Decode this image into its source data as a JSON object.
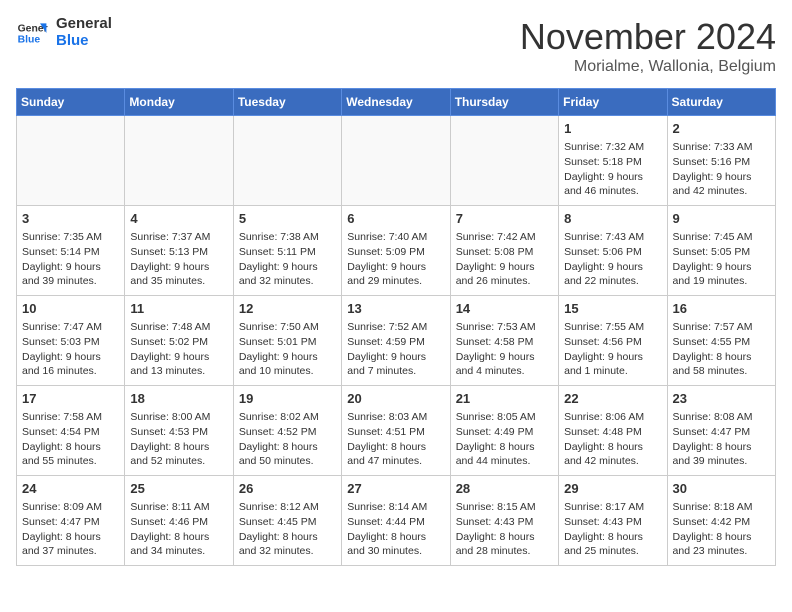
{
  "logo": {
    "line1": "General",
    "line2": "Blue"
  },
  "title": "November 2024",
  "location": "Morialme, Wallonia, Belgium",
  "days_of_week": [
    "Sunday",
    "Monday",
    "Tuesday",
    "Wednesday",
    "Thursday",
    "Friday",
    "Saturday"
  ],
  "weeks": [
    [
      {
        "day": "",
        "info": ""
      },
      {
        "day": "",
        "info": ""
      },
      {
        "day": "",
        "info": ""
      },
      {
        "day": "",
        "info": ""
      },
      {
        "day": "",
        "info": ""
      },
      {
        "day": "1",
        "info": "Sunrise: 7:32 AM\nSunset: 5:18 PM\nDaylight: 9 hours and 46 minutes."
      },
      {
        "day": "2",
        "info": "Sunrise: 7:33 AM\nSunset: 5:16 PM\nDaylight: 9 hours and 42 minutes."
      }
    ],
    [
      {
        "day": "3",
        "info": "Sunrise: 7:35 AM\nSunset: 5:14 PM\nDaylight: 9 hours and 39 minutes."
      },
      {
        "day": "4",
        "info": "Sunrise: 7:37 AM\nSunset: 5:13 PM\nDaylight: 9 hours and 35 minutes."
      },
      {
        "day": "5",
        "info": "Sunrise: 7:38 AM\nSunset: 5:11 PM\nDaylight: 9 hours and 32 minutes."
      },
      {
        "day": "6",
        "info": "Sunrise: 7:40 AM\nSunset: 5:09 PM\nDaylight: 9 hours and 29 minutes."
      },
      {
        "day": "7",
        "info": "Sunrise: 7:42 AM\nSunset: 5:08 PM\nDaylight: 9 hours and 26 minutes."
      },
      {
        "day": "8",
        "info": "Sunrise: 7:43 AM\nSunset: 5:06 PM\nDaylight: 9 hours and 22 minutes."
      },
      {
        "day": "9",
        "info": "Sunrise: 7:45 AM\nSunset: 5:05 PM\nDaylight: 9 hours and 19 minutes."
      }
    ],
    [
      {
        "day": "10",
        "info": "Sunrise: 7:47 AM\nSunset: 5:03 PM\nDaylight: 9 hours and 16 minutes."
      },
      {
        "day": "11",
        "info": "Sunrise: 7:48 AM\nSunset: 5:02 PM\nDaylight: 9 hours and 13 minutes."
      },
      {
        "day": "12",
        "info": "Sunrise: 7:50 AM\nSunset: 5:01 PM\nDaylight: 9 hours and 10 minutes."
      },
      {
        "day": "13",
        "info": "Sunrise: 7:52 AM\nSunset: 4:59 PM\nDaylight: 9 hours and 7 minutes."
      },
      {
        "day": "14",
        "info": "Sunrise: 7:53 AM\nSunset: 4:58 PM\nDaylight: 9 hours and 4 minutes."
      },
      {
        "day": "15",
        "info": "Sunrise: 7:55 AM\nSunset: 4:56 PM\nDaylight: 9 hours and 1 minute."
      },
      {
        "day": "16",
        "info": "Sunrise: 7:57 AM\nSunset: 4:55 PM\nDaylight: 8 hours and 58 minutes."
      }
    ],
    [
      {
        "day": "17",
        "info": "Sunrise: 7:58 AM\nSunset: 4:54 PM\nDaylight: 8 hours and 55 minutes."
      },
      {
        "day": "18",
        "info": "Sunrise: 8:00 AM\nSunset: 4:53 PM\nDaylight: 8 hours and 52 minutes."
      },
      {
        "day": "19",
        "info": "Sunrise: 8:02 AM\nSunset: 4:52 PM\nDaylight: 8 hours and 50 minutes."
      },
      {
        "day": "20",
        "info": "Sunrise: 8:03 AM\nSunset: 4:51 PM\nDaylight: 8 hours and 47 minutes."
      },
      {
        "day": "21",
        "info": "Sunrise: 8:05 AM\nSunset: 4:49 PM\nDaylight: 8 hours and 44 minutes."
      },
      {
        "day": "22",
        "info": "Sunrise: 8:06 AM\nSunset: 4:48 PM\nDaylight: 8 hours and 42 minutes."
      },
      {
        "day": "23",
        "info": "Sunrise: 8:08 AM\nSunset: 4:47 PM\nDaylight: 8 hours and 39 minutes."
      }
    ],
    [
      {
        "day": "24",
        "info": "Sunrise: 8:09 AM\nSunset: 4:47 PM\nDaylight: 8 hours and 37 minutes."
      },
      {
        "day": "25",
        "info": "Sunrise: 8:11 AM\nSunset: 4:46 PM\nDaylight: 8 hours and 34 minutes."
      },
      {
        "day": "26",
        "info": "Sunrise: 8:12 AM\nSunset: 4:45 PM\nDaylight: 8 hours and 32 minutes."
      },
      {
        "day": "27",
        "info": "Sunrise: 8:14 AM\nSunset: 4:44 PM\nDaylight: 8 hours and 30 minutes."
      },
      {
        "day": "28",
        "info": "Sunrise: 8:15 AM\nSunset: 4:43 PM\nDaylight: 8 hours and 28 minutes."
      },
      {
        "day": "29",
        "info": "Sunrise: 8:17 AM\nSunset: 4:43 PM\nDaylight: 8 hours and 25 minutes."
      },
      {
        "day": "30",
        "info": "Sunrise: 8:18 AM\nSunset: 4:42 PM\nDaylight: 8 hours and 23 minutes."
      }
    ]
  ]
}
